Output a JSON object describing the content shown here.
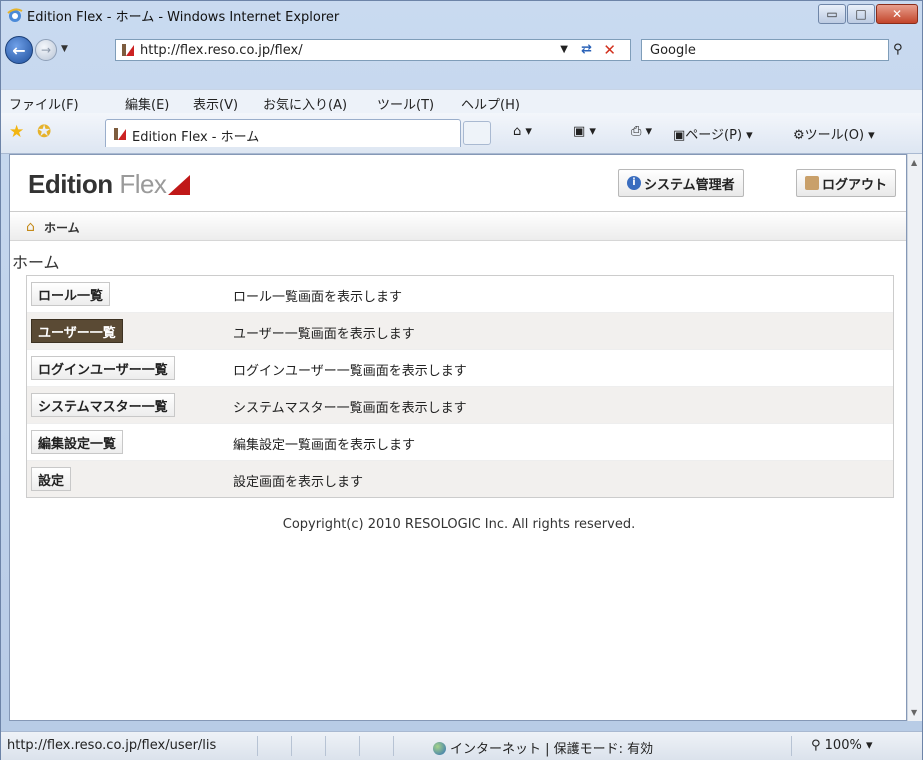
{
  "window": {
    "title": "Edition Flex - ホーム - Windows Internet Explorer",
    "min_glyph": "▭",
    "max_glyph": "□",
    "close_glyph": "✕"
  },
  "address": {
    "url": "http://flex.reso.co.jp/flex/",
    "search_engine": "Google"
  },
  "menubar": {
    "file": "ファイル(F)",
    "edit": "編集(E)",
    "view": "表示(V)",
    "favorites": "お気に入り(A)",
    "tools": "ツール(T)",
    "help": "ヘルプ(H)"
  },
  "tabs": {
    "active_tab": "Edition Flex - ホーム"
  },
  "commandbar": {
    "page": "ページ(P)",
    "tools": "ツール(O)"
  },
  "app": {
    "logo_main": "Edition",
    "logo_sub": " Flex",
    "system_admin_button": "システム管理者",
    "logout_button": "ログアウト",
    "breadcrumb_home": "ホーム",
    "page_heading": "ホーム",
    "menu": [
      {
        "label": "ロール一覧",
        "description": "ロール一覧画面を表示します"
      },
      {
        "label": "ユーザー一覧",
        "description": "ユーザー一覧画面を表示します"
      },
      {
        "label": "ログインユーザー一覧",
        "description": "ログインユーザー一覧画面を表示します"
      },
      {
        "label": "システムマスター一覧",
        "description": "システムマスター一覧画面を表示します"
      },
      {
        "label": "編集設定一覧",
        "description": "編集設定一覧画面を表示します"
      },
      {
        "label": "設定",
        "description": "設定画面を表示します"
      }
    ],
    "copyright": "Copyright(c) 2010 RESOLOGIC Inc. All rights reserved."
  },
  "status": {
    "link_url": "http://flex.reso.co.jp/flex/user/lis",
    "zone": "インターネット | 保護モード: 有効",
    "zoom": "100%"
  },
  "colors": {
    "brand_red": "#c01818",
    "active_menu_bg": "#5a4a34"
  }
}
